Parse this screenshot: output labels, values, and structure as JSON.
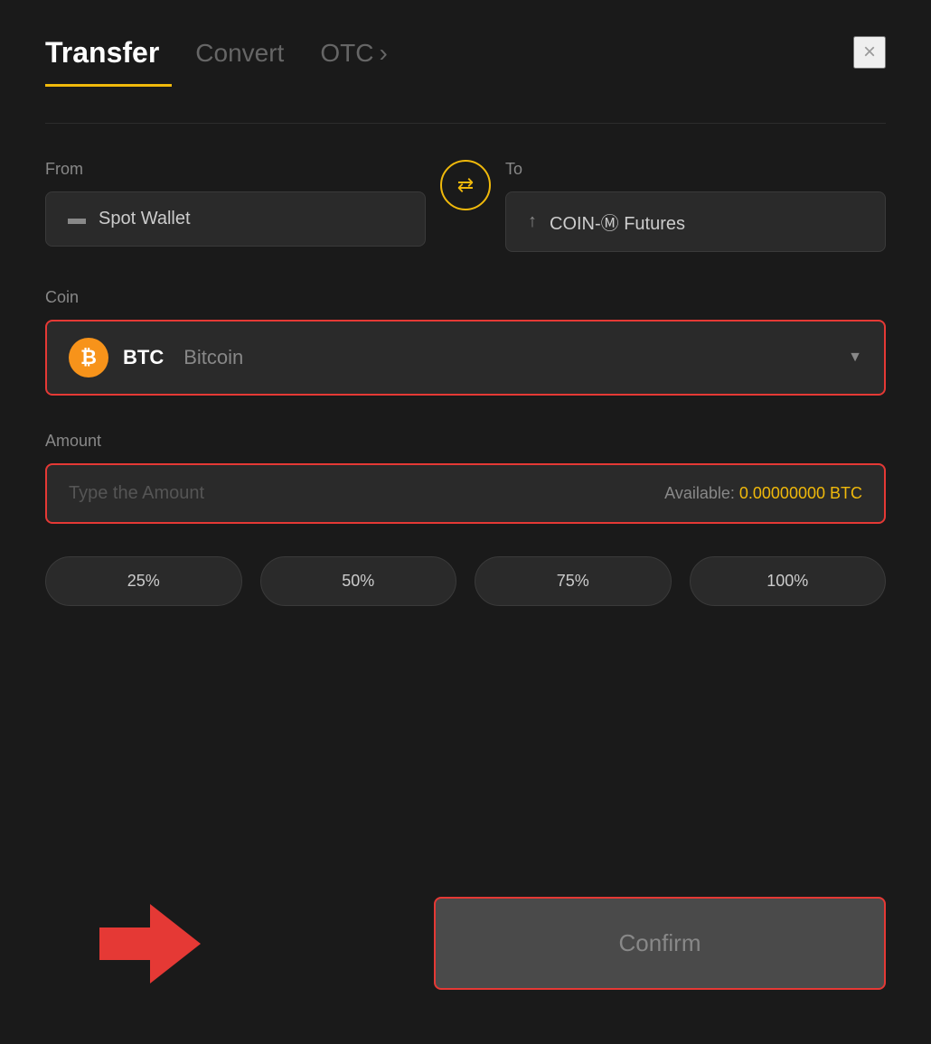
{
  "header": {
    "tab_transfer": "Transfer",
    "tab_convert": "Convert",
    "tab_otc": "OTC",
    "close_label": "×",
    "otc_chevron": "›"
  },
  "from_section": {
    "label": "From",
    "wallet_name": "Spot Wallet"
  },
  "to_section": {
    "label": "To",
    "wallet_name": "COIN-Ⓜ Futures"
  },
  "coin_section": {
    "label": "Coin",
    "coin_symbol": "BTC",
    "coin_name": "Bitcoin",
    "btc_letter": "₿"
  },
  "amount_section": {
    "label": "Amount",
    "placeholder": "Type the Amount",
    "available_label": "Available:",
    "available_amount": "0.00000000 BTC"
  },
  "percent_buttons": [
    "25%",
    "50%",
    "75%",
    "100%"
  ],
  "confirm_button": {
    "label": "Confirm"
  },
  "colors": {
    "accent": "#f0b90b",
    "danger": "#e53935",
    "bg": "#1a1a1a",
    "card": "#2a2a2a"
  }
}
